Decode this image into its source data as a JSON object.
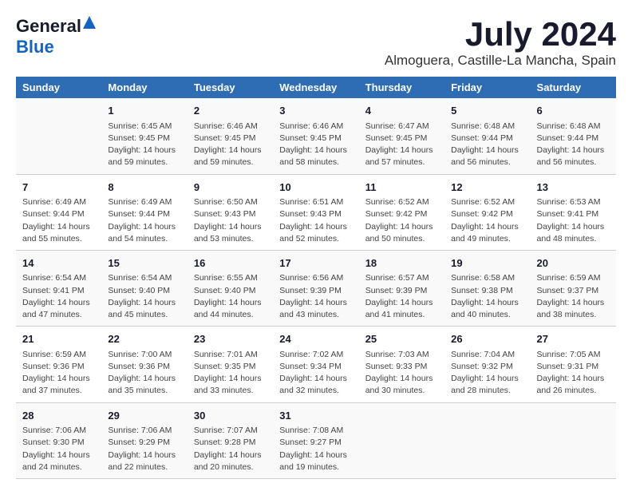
{
  "logo": {
    "general": "General",
    "blue": "Blue"
  },
  "title": "July 2024",
  "location": "Almoguera, Castille-La Mancha, Spain",
  "days_of_week": [
    "Sunday",
    "Monday",
    "Tuesday",
    "Wednesday",
    "Thursday",
    "Friday",
    "Saturday"
  ],
  "weeks": [
    [
      {
        "date": "",
        "info": ""
      },
      {
        "date": "1",
        "info": "Sunrise: 6:45 AM\nSunset: 9:45 PM\nDaylight: 14 hours and 59 minutes."
      },
      {
        "date": "2",
        "info": "Sunrise: 6:46 AM\nSunset: 9:45 PM\nDaylight: 14 hours and 59 minutes."
      },
      {
        "date": "3",
        "info": "Sunrise: 6:46 AM\nSunset: 9:45 PM\nDaylight: 14 hours and 58 minutes."
      },
      {
        "date": "4",
        "info": "Sunrise: 6:47 AM\nSunset: 9:45 PM\nDaylight: 14 hours and 57 minutes."
      },
      {
        "date": "5",
        "info": "Sunrise: 6:48 AM\nSunset: 9:44 PM\nDaylight: 14 hours and 56 minutes."
      },
      {
        "date": "6",
        "info": "Sunrise: 6:48 AM\nSunset: 9:44 PM\nDaylight: 14 hours and 56 minutes."
      }
    ],
    [
      {
        "date": "7",
        "info": "Sunrise: 6:49 AM\nSunset: 9:44 PM\nDaylight: 14 hours and 55 minutes."
      },
      {
        "date": "8",
        "info": "Sunrise: 6:49 AM\nSunset: 9:44 PM\nDaylight: 14 hours and 54 minutes."
      },
      {
        "date": "9",
        "info": "Sunrise: 6:50 AM\nSunset: 9:43 PM\nDaylight: 14 hours and 53 minutes."
      },
      {
        "date": "10",
        "info": "Sunrise: 6:51 AM\nSunset: 9:43 PM\nDaylight: 14 hours and 52 minutes."
      },
      {
        "date": "11",
        "info": "Sunrise: 6:52 AM\nSunset: 9:42 PM\nDaylight: 14 hours and 50 minutes."
      },
      {
        "date": "12",
        "info": "Sunrise: 6:52 AM\nSunset: 9:42 PM\nDaylight: 14 hours and 49 minutes."
      },
      {
        "date": "13",
        "info": "Sunrise: 6:53 AM\nSunset: 9:41 PM\nDaylight: 14 hours and 48 minutes."
      }
    ],
    [
      {
        "date": "14",
        "info": "Sunrise: 6:54 AM\nSunset: 9:41 PM\nDaylight: 14 hours and 47 minutes."
      },
      {
        "date": "15",
        "info": "Sunrise: 6:54 AM\nSunset: 9:40 PM\nDaylight: 14 hours and 45 minutes."
      },
      {
        "date": "16",
        "info": "Sunrise: 6:55 AM\nSunset: 9:40 PM\nDaylight: 14 hours and 44 minutes."
      },
      {
        "date": "17",
        "info": "Sunrise: 6:56 AM\nSunset: 9:39 PM\nDaylight: 14 hours and 43 minutes."
      },
      {
        "date": "18",
        "info": "Sunrise: 6:57 AM\nSunset: 9:39 PM\nDaylight: 14 hours and 41 minutes."
      },
      {
        "date": "19",
        "info": "Sunrise: 6:58 AM\nSunset: 9:38 PM\nDaylight: 14 hours and 40 minutes."
      },
      {
        "date": "20",
        "info": "Sunrise: 6:59 AM\nSunset: 9:37 PM\nDaylight: 14 hours and 38 minutes."
      }
    ],
    [
      {
        "date": "21",
        "info": "Sunrise: 6:59 AM\nSunset: 9:36 PM\nDaylight: 14 hours and 37 minutes."
      },
      {
        "date": "22",
        "info": "Sunrise: 7:00 AM\nSunset: 9:36 PM\nDaylight: 14 hours and 35 minutes."
      },
      {
        "date": "23",
        "info": "Sunrise: 7:01 AM\nSunset: 9:35 PM\nDaylight: 14 hours and 33 minutes."
      },
      {
        "date": "24",
        "info": "Sunrise: 7:02 AM\nSunset: 9:34 PM\nDaylight: 14 hours and 32 minutes."
      },
      {
        "date": "25",
        "info": "Sunrise: 7:03 AM\nSunset: 9:33 PM\nDaylight: 14 hours and 30 minutes."
      },
      {
        "date": "26",
        "info": "Sunrise: 7:04 AM\nSunset: 9:32 PM\nDaylight: 14 hours and 28 minutes."
      },
      {
        "date": "27",
        "info": "Sunrise: 7:05 AM\nSunset: 9:31 PM\nDaylight: 14 hours and 26 minutes."
      }
    ],
    [
      {
        "date": "28",
        "info": "Sunrise: 7:06 AM\nSunset: 9:30 PM\nDaylight: 14 hours and 24 minutes."
      },
      {
        "date": "29",
        "info": "Sunrise: 7:06 AM\nSunset: 9:29 PM\nDaylight: 14 hours and 22 minutes."
      },
      {
        "date": "30",
        "info": "Sunrise: 7:07 AM\nSunset: 9:28 PM\nDaylight: 14 hours and 20 minutes."
      },
      {
        "date": "31",
        "info": "Sunrise: 7:08 AM\nSunset: 9:27 PM\nDaylight: 14 hours and 19 minutes."
      },
      {
        "date": "",
        "info": ""
      },
      {
        "date": "",
        "info": ""
      },
      {
        "date": "",
        "info": ""
      }
    ]
  ]
}
